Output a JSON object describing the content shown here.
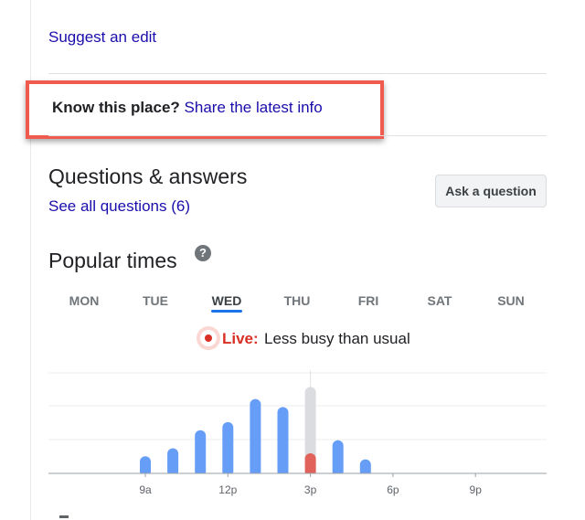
{
  "suggest_edit": "Suggest an edit",
  "know_place": {
    "prompt": "Know this place?",
    "link": "Share the latest info"
  },
  "questions": {
    "title": "Questions & answers",
    "see_all": "See all questions (6)",
    "ask_button": "Ask a question"
  },
  "popular_times": {
    "title": "Popular times",
    "help_icon": "help-circle-icon",
    "days": [
      "MON",
      "TUE",
      "WED",
      "THU",
      "FRI",
      "SAT",
      "SUN"
    ],
    "selected_day": "WED",
    "live_label": "Live:",
    "live_text": "Less busy than usual"
  },
  "colors": {
    "link": "#1a0dab",
    "highlight_border": "#ef5b4f",
    "bar": "#669df6",
    "bar_current_usual": "#dadce0",
    "bar_live": "#e0625a",
    "live_red": "#d93025",
    "tab_underline": "#1a73e8"
  },
  "chart_data": {
    "type": "bar",
    "x_ticks": [
      "9a",
      "12p",
      "3p",
      "6p",
      "9p"
    ],
    "hours": [
      "9a",
      "10a",
      "11a",
      "12p",
      "1p",
      "2p",
      "3p",
      "4p",
      "5p"
    ],
    "values": [
      17,
      25,
      43,
      51,
      74,
      66,
      86,
      33,
      14
    ],
    "current_hour": "3p",
    "live_value": 20,
    "ylim": [
      0,
      100
    ],
    "grid": true
  }
}
